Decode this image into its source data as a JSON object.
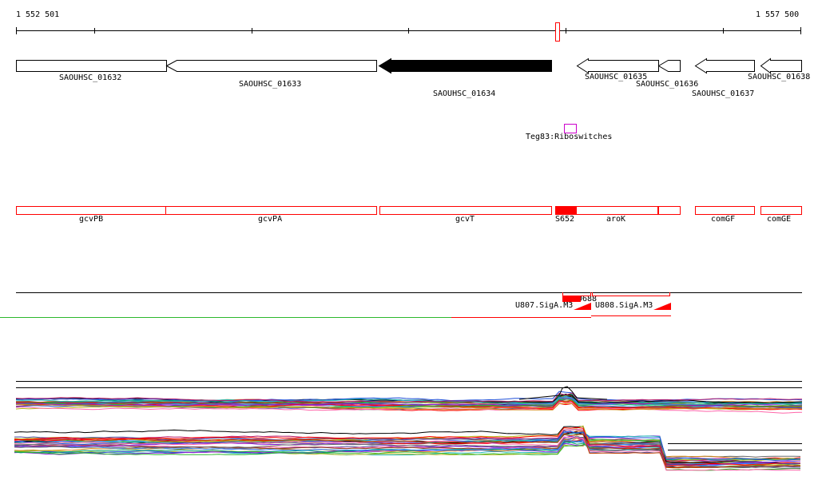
{
  "coordinates": {
    "start": "1 552 501",
    "end": "1 557 500"
  },
  "genes": [
    {
      "name": "SAOUHSC_01632"
    },
    {
      "name": "SAOUHSC_01633"
    },
    {
      "name": "SAOUHSC_01634"
    },
    {
      "name": "SAOUHSC_01635"
    },
    {
      "name": "SAOUHSC_01636"
    },
    {
      "name": "SAOUHSC_01637"
    },
    {
      "name": "SAOUHSC_01638"
    }
  ],
  "riboswitch": {
    "label": "Teg83:Riboswitches"
  },
  "annotations": [
    {
      "name": "gcvPB"
    },
    {
      "name": "gcvPA"
    },
    {
      "name": "gcvT"
    },
    {
      "name": "S652"
    },
    {
      "name": "aroK"
    },
    {
      "name": "comGF"
    },
    {
      "name": "comGE"
    }
  ],
  "promoters": [
    {
      "name": "U807.SigA.M3"
    },
    {
      "name": "D688"
    },
    {
      "name": "U808.SigA.M3"
    }
  ],
  "colors": {
    "gene_outline": "#000000",
    "annotation": "#ff0000",
    "riboswitch": "#cc00cc",
    "green_track": "#2db82d"
  }
}
